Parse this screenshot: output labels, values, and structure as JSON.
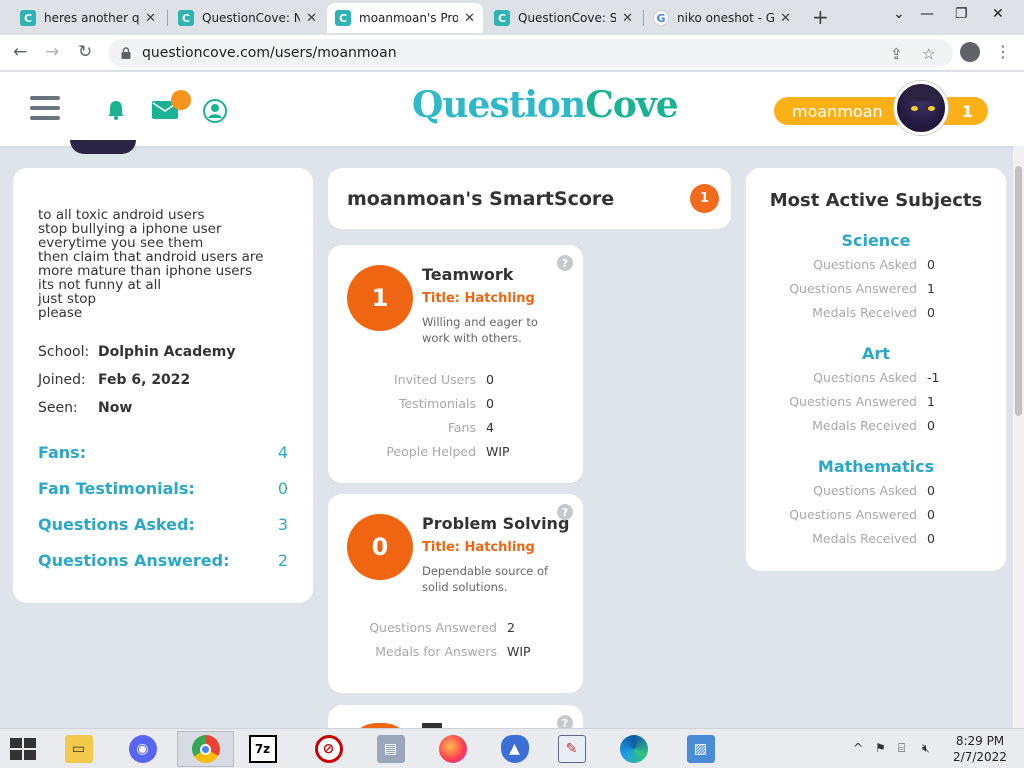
{
  "browser": {
    "tabs": [
      {
        "title": "heres another qu",
        "favicon": "questioncove-icon"
      },
      {
        "title": "QuestionCove: No",
        "favicon": "questioncove-icon"
      },
      {
        "title": "moanmoan's Prof",
        "favicon": "questioncove-icon",
        "active": true
      },
      {
        "title": "QuestionCove: Se",
        "favicon": "questioncove-icon"
      },
      {
        "title": "niko oneshot - Go",
        "favicon": "google-icon"
      }
    ],
    "url": "questioncove.com/users/moanmoan"
  },
  "header": {
    "logo_q": "Q",
    "logo_a": "uestion",
    "logo_c": "C",
    "logo_b": "ove",
    "username": "moanmoan",
    "points": "1"
  },
  "profile": {
    "bio": "to all toxic android users\nstop bullying a iphone user\neverytime you see them\nthen claim that android users are\nmore mature than iphone users\nits not funny at all\njust stop\nplease",
    "school_label": "School:",
    "school": "Dolphin Academy",
    "joined_label": "Joined:",
    "joined": "Feb 6, 2022",
    "seen_label": "Seen:",
    "seen": "Now",
    "stats": [
      {
        "label": "Fans:",
        "value": "4"
      },
      {
        "label": "Fan Testimonials:",
        "value": "0"
      },
      {
        "label": "Questions Asked:",
        "value": "3"
      },
      {
        "label": "Questions Answered:",
        "value": "2"
      }
    ]
  },
  "smartscore": {
    "title": "moanmoan's SmartScore",
    "badge": "1"
  },
  "skills": [
    {
      "score": "1",
      "name": "Teamwork",
      "title": "Title: Hatchling",
      "desc": "Willing and eager to work with others.",
      "rows": [
        {
          "k": "Invited Users",
          "v": "0"
        },
        {
          "k": "Testimonials",
          "v": "0"
        },
        {
          "k": "Fans",
          "v": "4"
        },
        {
          "k": "People Helped",
          "v": "WIP"
        }
      ]
    },
    {
      "score": "0",
      "name": "Problem Solving",
      "title": "Title: Hatchling",
      "desc": "Dependable source of solid solutions.",
      "rows": [
        {
          "k": "Questions Answered",
          "v": "2"
        },
        {
          "k": "Medals for Answers",
          "v": "WIP"
        }
      ]
    }
  ],
  "subjects": {
    "heading": "Most Active Subjects",
    "items": [
      {
        "name": "Science",
        "rows": [
          {
            "k": "Questions Asked",
            "v": "0"
          },
          {
            "k": "Questions Answered",
            "v": "1"
          },
          {
            "k": "Medals Received",
            "v": "0"
          }
        ]
      },
      {
        "name": "Art",
        "rows": [
          {
            "k": "Questions Asked",
            "v": "-1"
          },
          {
            "k": "Questions Answered",
            "v": "1"
          },
          {
            "k": "Medals Received",
            "v": "0"
          }
        ]
      },
      {
        "name": "Mathematics",
        "rows": [
          {
            "k": "Questions Asked",
            "v": "0"
          },
          {
            "k": "Questions Answered",
            "v": "0"
          },
          {
            "k": "Medals Received",
            "v": "0"
          }
        ]
      }
    ]
  },
  "taskbar": {
    "time": "8:29 PM",
    "date": "2/7/2022"
  },
  "colors": {
    "accent": "#2aa8c9",
    "orange": "#f06511",
    "pill": "#fbb017",
    "background": "#dfe3ea"
  }
}
